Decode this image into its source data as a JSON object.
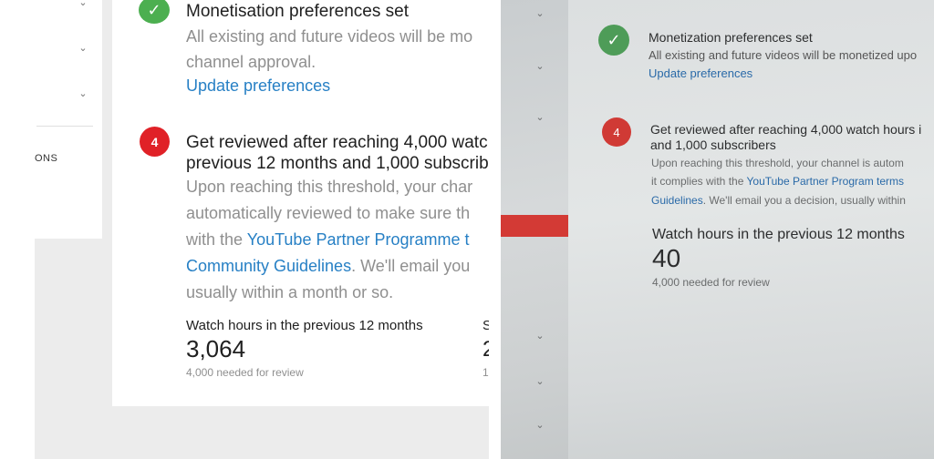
{
  "left": {
    "sidebar": {
      "section_label": "ONS"
    },
    "monetisation": {
      "title": "Monetisation preferences set",
      "desc_line1": "All existing and future videos will be mo",
      "desc_line2": "channel approval.",
      "link": "Update preferences"
    },
    "review": {
      "step": "4",
      "heading_line1": "Get reviewed after reaching 4,000 watc",
      "heading_line2": "previous 12 months and 1,000 subscrib",
      "desc_line1": "Upon reaching this threshold, your char",
      "desc_line2": "automatically reviewed to make sure th",
      "desc_line3_prefix": "with the ",
      "desc_line3_link": "YouTube Partner Programme t",
      "desc_line4_link": "Community Guidelines",
      "desc_line4_suffix": ". We'll email you",
      "desc_line5": "usually within a month or so."
    },
    "watch_hours": {
      "label": "Watch hours in the previous 12 months",
      "value": "3,064",
      "needed": "4,000 needed for review"
    },
    "edge_fragments": {
      "label": "S",
      "value": "2",
      "needed": "1"
    }
  },
  "right": {
    "monetization": {
      "title": "Monetization preferences set",
      "desc": "All existing and future videos will be monetized upo",
      "link": "Update preferences"
    },
    "review": {
      "step": "4",
      "heading_line1": "Get reviewed after reaching 4,000 watch hours i",
      "heading_line2": "and 1,000 subscribers",
      "desc_line1": "Upon reaching this threshold, your channel is autom",
      "desc_line2_prefix": "it complies with the ",
      "desc_line2_link": "YouTube Partner Program terms",
      "desc_line3_link": "Guidelines",
      "desc_line3_suffix": ". We'll email you a decision, usually within"
    },
    "watch_hours": {
      "label": "Watch hours in the previous 12 months",
      "value": "40",
      "needed": "4,000 needed for review"
    }
  },
  "icons": {
    "check": "check-icon",
    "chevron": "chevron-down-icon"
  },
  "colors": {
    "check_green": "#4caf50",
    "step_red": "#e02127",
    "link_blue": "#2780c5"
  }
}
